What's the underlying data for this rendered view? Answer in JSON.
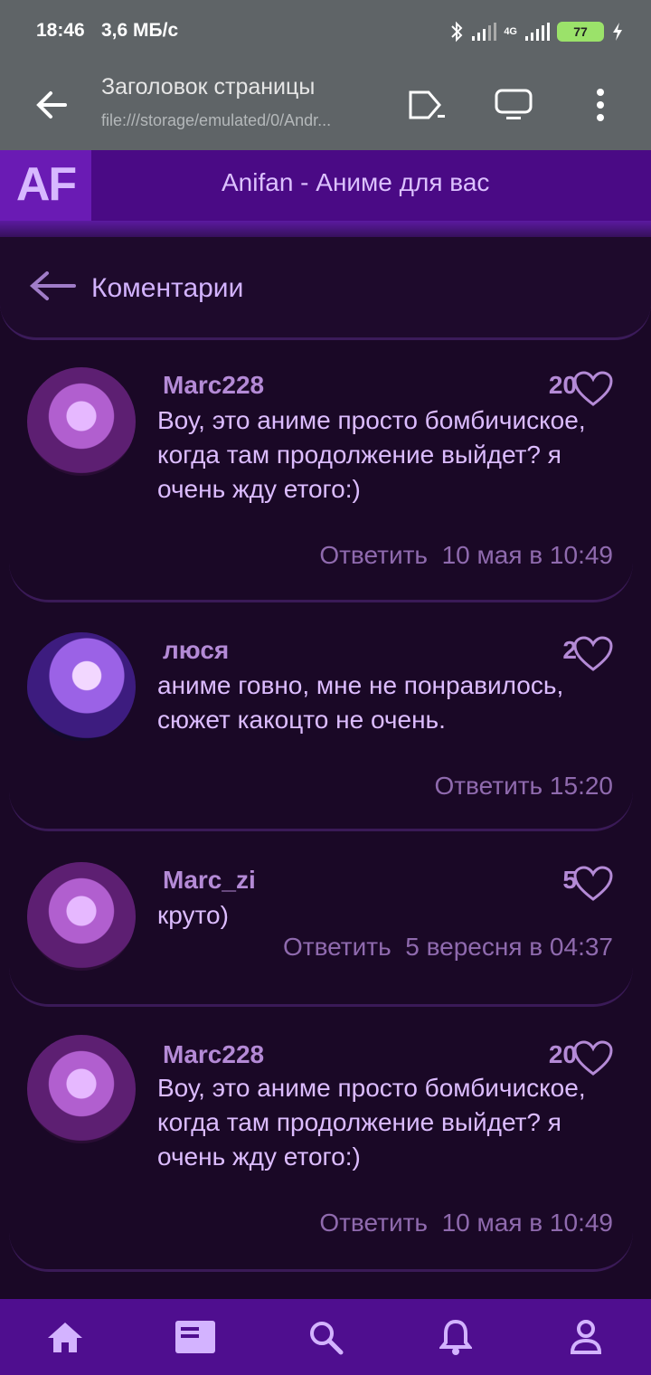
{
  "status_bar": {
    "time": "18:46",
    "speed": "3,6 МБ/с",
    "network": "4G",
    "battery": "77"
  },
  "browser": {
    "title": "Заголовок страницы",
    "url": "file:///storage/emulated/0/Andr..."
  },
  "app": {
    "logo": "AF",
    "title": "Anifan - Аниме для вас"
  },
  "comments_section": {
    "title": "Коментарии"
  },
  "comments": [
    {
      "author": "Marc228",
      "likes": "20",
      "text": "Воу, это аниме просто бомбичиское, когда там продолжение выйдет? я очень жду етого:)",
      "reply": "Ответить",
      "time": "10 мая в 10:49"
    },
    {
      "author": "люся",
      "likes": "2",
      "text": "аниме говно, мне не понравилось, сюжет какоцто не очень.",
      "reply": "Ответить",
      "time": "15:20"
    },
    {
      "author": "Marc_zi",
      "likes": "5",
      "text": "круто)",
      "reply": "Ответить",
      "time": "5 вересня в 04:37"
    },
    {
      "author": "Marc228",
      "likes": "20",
      "text": "Воу, это аниме просто бомбичиское, когда там продолжение выйдет? я очень жду етого:)",
      "reply": "Ответить",
      "time": "10 мая в 10:49"
    }
  ],
  "bottom_nav": {
    "items": [
      "home-icon",
      "news-icon",
      "search-icon",
      "notifications-icon",
      "profile-icon"
    ]
  },
  "colors": {
    "background": "#1a0826",
    "header": "#4a0a85",
    "accent": "#b48ad6",
    "text": "#dcbcff"
  }
}
